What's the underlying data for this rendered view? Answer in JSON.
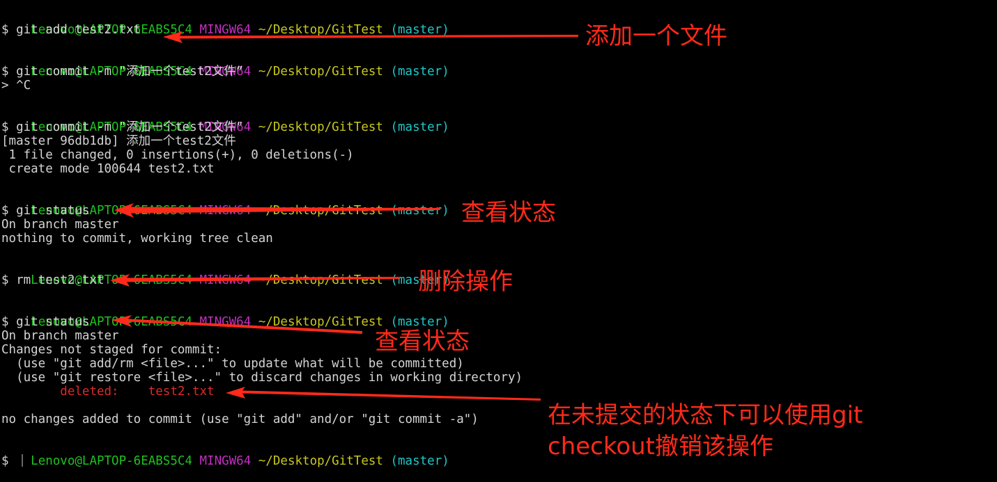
{
  "prompt": {
    "user_host": "Lenovo@LAPTOP-6EABS5C4",
    "env": "MINGW64",
    "path": "~/Desktop/GitTest",
    "branch": "(master)"
  },
  "terminal": {
    "command_1": "$ git add test2.txt",
    "command_2": "$ git commit -m \"添加一个test2文件“",
    "continuation_2": "> ^C",
    "command_3": "$ git commit -m \"添加一个test2文件\"",
    "commit_result": "[master 96db1db] 添加一个test2文件",
    "commit_stats": " 1 file changed, 0 insertions(+), 0 deletions(-)",
    "commit_create": " create mode 100644 test2.txt",
    "command_4": "$ git status",
    "status_branch_1": "On branch master",
    "status_clean": "nothing to commit, working tree clean",
    "command_5": "$ rm test2.txt",
    "command_6": "$ git status",
    "status_branch_2": "On branch master",
    "status_not_staged": "Changes not staged for commit:",
    "hint_add": "  (use \"git add/rm <file>...\" to update what will be committed)",
    "hint_restore": "  (use \"git restore <file>...\" to discard changes in working directory)",
    "deleted_indent": "        ",
    "deleted_label": "deleted:    test2.txt",
    "no_changes": "no changes added to commit (use \"git add\" and/or \"git commit -a\")",
    "final_prompt": "$ "
  },
  "annotations": {
    "add_file": "添加一个文件",
    "view_status_1": "查看状态",
    "delete_op": "删除操作",
    "view_status_2": "查看状态",
    "undo_line_1": "在未提交的状态下可以使用git",
    "undo_line_2": "checkout撤销该操作"
  },
  "colors": {
    "background": "#000000",
    "text": "#d4d4d4",
    "user_host": "#1ec31e",
    "env": "#c12fc1",
    "path": "#c8c81e",
    "branch": "#1ec8c8",
    "deleted": "#dc2a2a",
    "annotation": "#ff2a1a"
  }
}
